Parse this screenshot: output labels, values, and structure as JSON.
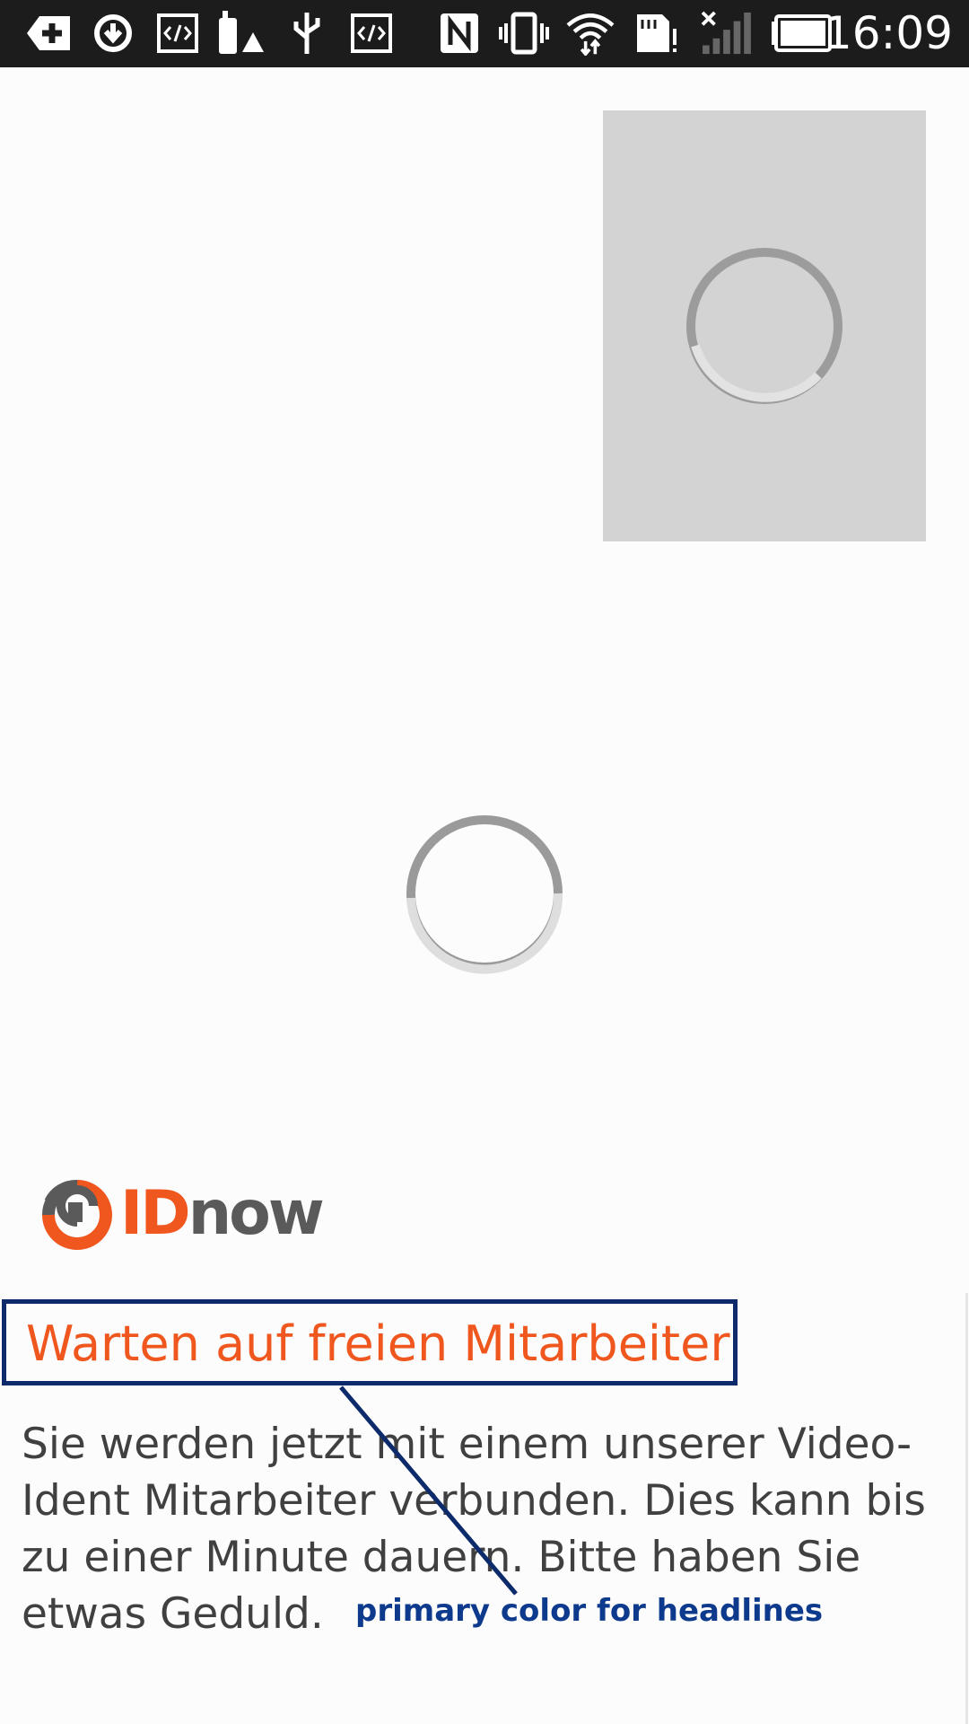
{
  "status_bar": {
    "time": "16:09",
    "icons": [
      "add-notification-icon",
      "sync-icon",
      "code-icon",
      "phone-alert-icon",
      "usb-icon",
      "code-icon",
      "nfc-icon",
      "vibrate-icon",
      "wifi-icon",
      "sd-card-alert-icon",
      "no-signal-icon",
      "battery-icon"
    ]
  },
  "video": {
    "preview_state": "loading",
    "main_state": "loading"
  },
  "logo": {
    "id_text": "ID",
    "now_text": "now"
  },
  "content": {
    "headline": "Warten auf freien Mitarbeiter",
    "body": "Sie werden jetzt mit einem unserer Video-Ident Mitarbeiter verbunden. Dies kann bis zu einer Minute dauern. Bitte haben Sie etwas Geduld."
  },
  "annotation": {
    "label": "primary color for headlines"
  },
  "colors": {
    "primary": "#f0571e",
    "annotation": "#0d2b6b",
    "status_bar": "#1c1c1c",
    "preview_bg": "#d3d3d3"
  }
}
